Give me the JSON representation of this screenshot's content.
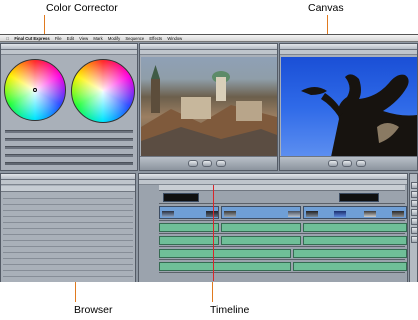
{
  "callouts": {
    "color_corrector": "Color Corrector",
    "canvas": "Canvas",
    "browser": "Browser",
    "timeline": "Timeline"
  },
  "colors": {
    "leader_line": "#e07a1f",
    "video_clip": "#6f9fd6",
    "audio_clip": "#6fbf98"
  },
  "menubar": {
    "app_name": "Final Cut Express",
    "items": [
      "File",
      "Edit",
      "View",
      "Mark",
      "Modify",
      "Sequence",
      "Effects",
      "Window"
    ]
  },
  "icons": [
    "apple-icon",
    "play-icon",
    "color-wheel-icon",
    "arrow-tool-icon",
    "razor-tool-icon",
    "zoom-tool-icon",
    "hand-tool-icon"
  ]
}
